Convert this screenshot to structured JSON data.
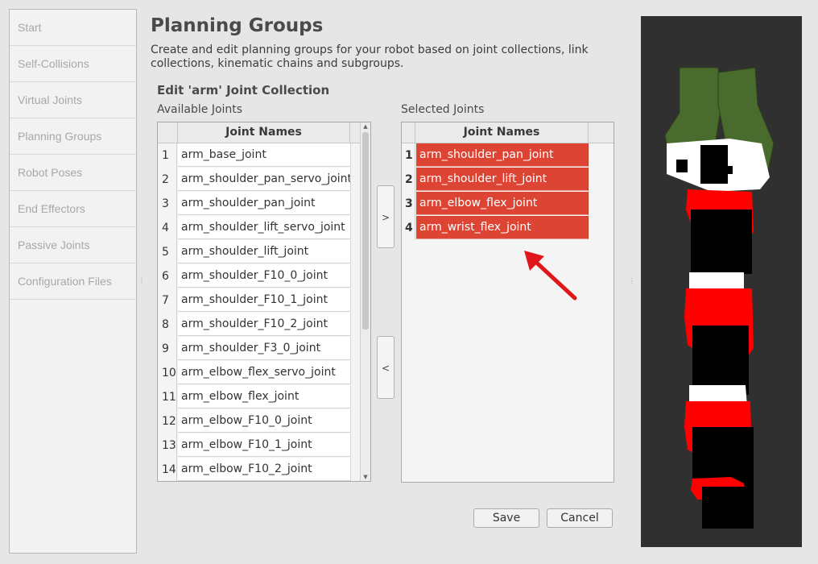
{
  "sidebar": {
    "items": [
      {
        "label": "Start"
      },
      {
        "label": "Self-Collisions"
      },
      {
        "label": "Virtual Joints"
      },
      {
        "label": "Planning Groups"
      },
      {
        "label": "Robot Poses"
      },
      {
        "label": "End Effectors"
      },
      {
        "label": "Passive Joints"
      },
      {
        "label": "Configuration Files"
      }
    ]
  },
  "header": {
    "title": "Planning Groups",
    "description": "Create and edit planning groups for your robot based on joint collections, link collections, kinematic chains and subgroups."
  },
  "editor": {
    "title": "Edit 'arm' Joint Collection",
    "available": {
      "caption": "Available Joints",
      "column": "Joint Names",
      "rows": [
        {
          "n": "1",
          "name": "arm_base_joint"
        },
        {
          "n": "2",
          "name": "arm_shoulder_pan_servo_joint"
        },
        {
          "n": "3",
          "name": "arm_shoulder_pan_joint"
        },
        {
          "n": "4",
          "name": "arm_shoulder_lift_servo_joint"
        },
        {
          "n": "5",
          "name": "arm_shoulder_lift_joint"
        },
        {
          "n": "6",
          "name": "arm_shoulder_F10_0_joint"
        },
        {
          "n": "7",
          "name": "arm_shoulder_F10_1_joint"
        },
        {
          "n": "8",
          "name": "arm_shoulder_F10_2_joint"
        },
        {
          "n": "9",
          "name": "arm_shoulder_F3_0_joint"
        },
        {
          "n": "10",
          "name": "arm_elbow_flex_servo_joint"
        },
        {
          "n": "11",
          "name": "arm_elbow_flex_joint"
        },
        {
          "n": "12",
          "name": "arm_elbow_F10_0_joint"
        },
        {
          "n": "13",
          "name": "arm_elbow_F10_1_joint"
        },
        {
          "n": "14",
          "name": "arm_elbow_F10_2_joint"
        }
      ]
    },
    "selected": {
      "caption": "Selected Joints",
      "column": "Joint Names",
      "rows": [
        {
          "n": "1",
          "name": "arm_shoulder_pan_joint"
        },
        {
          "n": "2",
          "name": "arm_shoulder_lift_joint"
        },
        {
          "n": "3",
          "name": "arm_elbow_flex_joint"
        },
        {
          "n": "4",
          "name": "arm_wrist_flex_joint"
        }
      ]
    },
    "add_label": ">",
    "remove_label": "<",
    "save_label": "Save",
    "cancel_label": "Cancel"
  },
  "colors": {
    "selection": "#dd4433",
    "annotation_arrow": "#e0161b",
    "gripper": "#4a6b2e",
    "link_red": "#ff0000",
    "viewport_bg": "#303030"
  }
}
